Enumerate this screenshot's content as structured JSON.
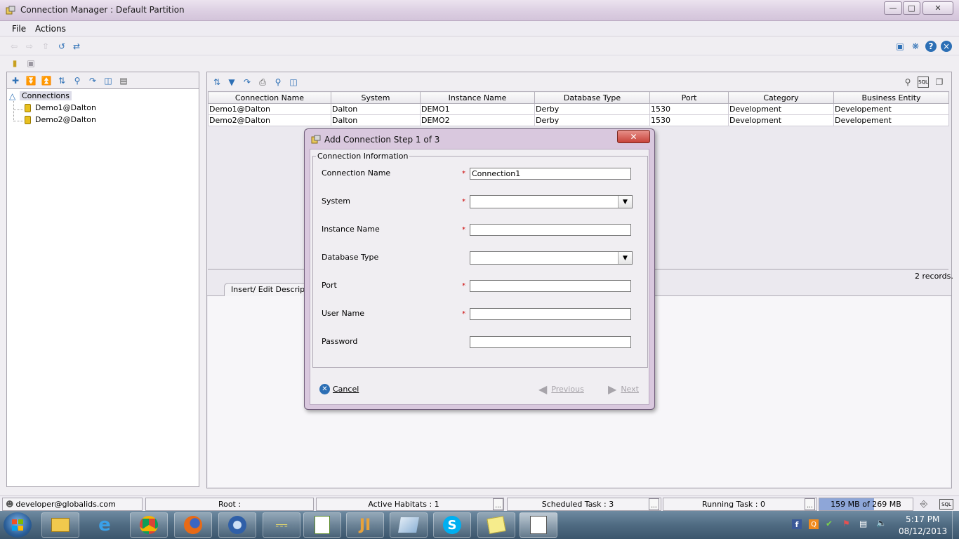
{
  "window": {
    "title": "Connection Manager : Default Partition",
    "min": "—",
    "max": "□",
    "close": "✕"
  },
  "menu": {
    "file": "File",
    "actions": "Actions"
  },
  "tree": {
    "root": "Connections",
    "items": [
      "Demo1@Dalton",
      "Demo2@Dalton"
    ]
  },
  "grid": {
    "columns": [
      "Connection Name",
      "System",
      "Instance Name",
      "Database Type",
      "Port",
      "Category",
      "Business Entity"
    ],
    "rows": [
      [
        "Demo1@Dalton",
        "Dalton",
        "DEMO1",
        "Derby",
        "1530",
        "Development",
        "Developement"
      ],
      [
        "Demo2@Dalton",
        "Dalton",
        "DEMO2",
        "Derby",
        "1530",
        "Development",
        "Developement"
      ]
    ],
    "records": "2 records."
  },
  "tabs": {
    "insert_edit": "Insert/ Edit Description"
  },
  "dialog": {
    "title": "Add Connection Step 1 of  3",
    "section": "Connection Information",
    "fields": {
      "connection_name": {
        "label": "Connection Name",
        "value": "Connection1"
      },
      "system": {
        "label": "System",
        "value": ""
      },
      "instance_name": {
        "label": "Instance Name",
        "value": ""
      },
      "database_type": {
        "label": "Database Type",
        "value": ""
      },
      "port": {
        "label": "Port",
        "value": ""
      },
      "user_name": {
        "label": "User Name",
        "value": ""
      },
      "password": {
        "label": "Password",
        "value": ""
      }
    },
    "required_mark": "*",
    "cancel": "Cancel",
    "previous": "Previous",
    "next": "Next"
  },
  "status": {
    "user": "developer@globalids.com",
    "root": "Root :",
    "habitats": "Active Habitats : 1",
    "scheduled": "Scheduled Task : 3",
    "running": "Running Task : 0",
    "memory": "159 MB of 269 MB",
    "memory_used_fraction": 0.59,
    "ellipsis": "...",
    "sql": "SQL"
  },
  "taskbar": {
    "time": "5:17 PM",
    "date": "08/12/2013"
  },
  "colors": {
    "dialog_frame": "#d9c8de",
    "required": "#cc0000",
    "memory_fill": "#8ea6d8",
    "close_red": "#c8433a"
  }
}
